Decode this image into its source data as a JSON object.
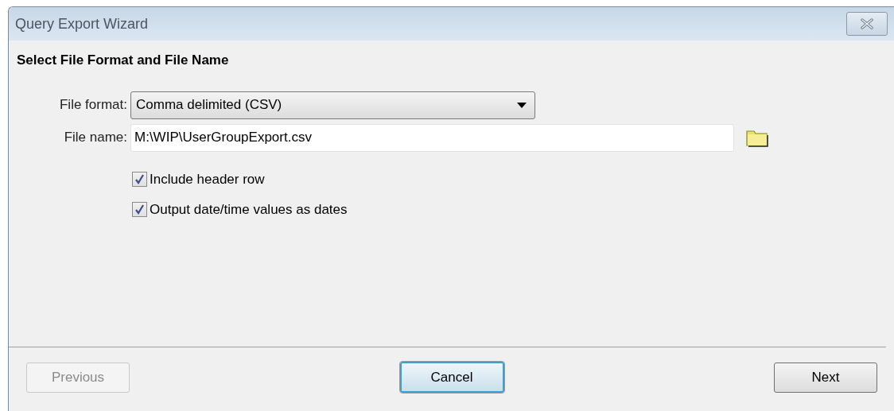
{
  "window": {
    "title": "Query Export Wizard"
  },
  "heading": "Select File Format and File Name",
  "file_format": {
    "label": "File format:",
    "value": "Comma delimited (CSV)"
  },
  "file_name": {
    "label": "File name:",
    "value": "M:\\WIP\\UserGroupExport.csv"
  },
  "options": [
    {
      "label": "Include header row",
      "checked": true
    },
    {
      "label": "Output date/time values as dates",
      "checked": true
    }
  ],
  "buttons": [
    {
      "label": "Previous",
      "disabled": true,
      "focused": false
    },
    {
      "label": "Cancel",
      "disabled": false,
      "focused": true
    },
    {
      "label": "Next",
      "disabled": false,
      "focused": false
    }
  ]
}
